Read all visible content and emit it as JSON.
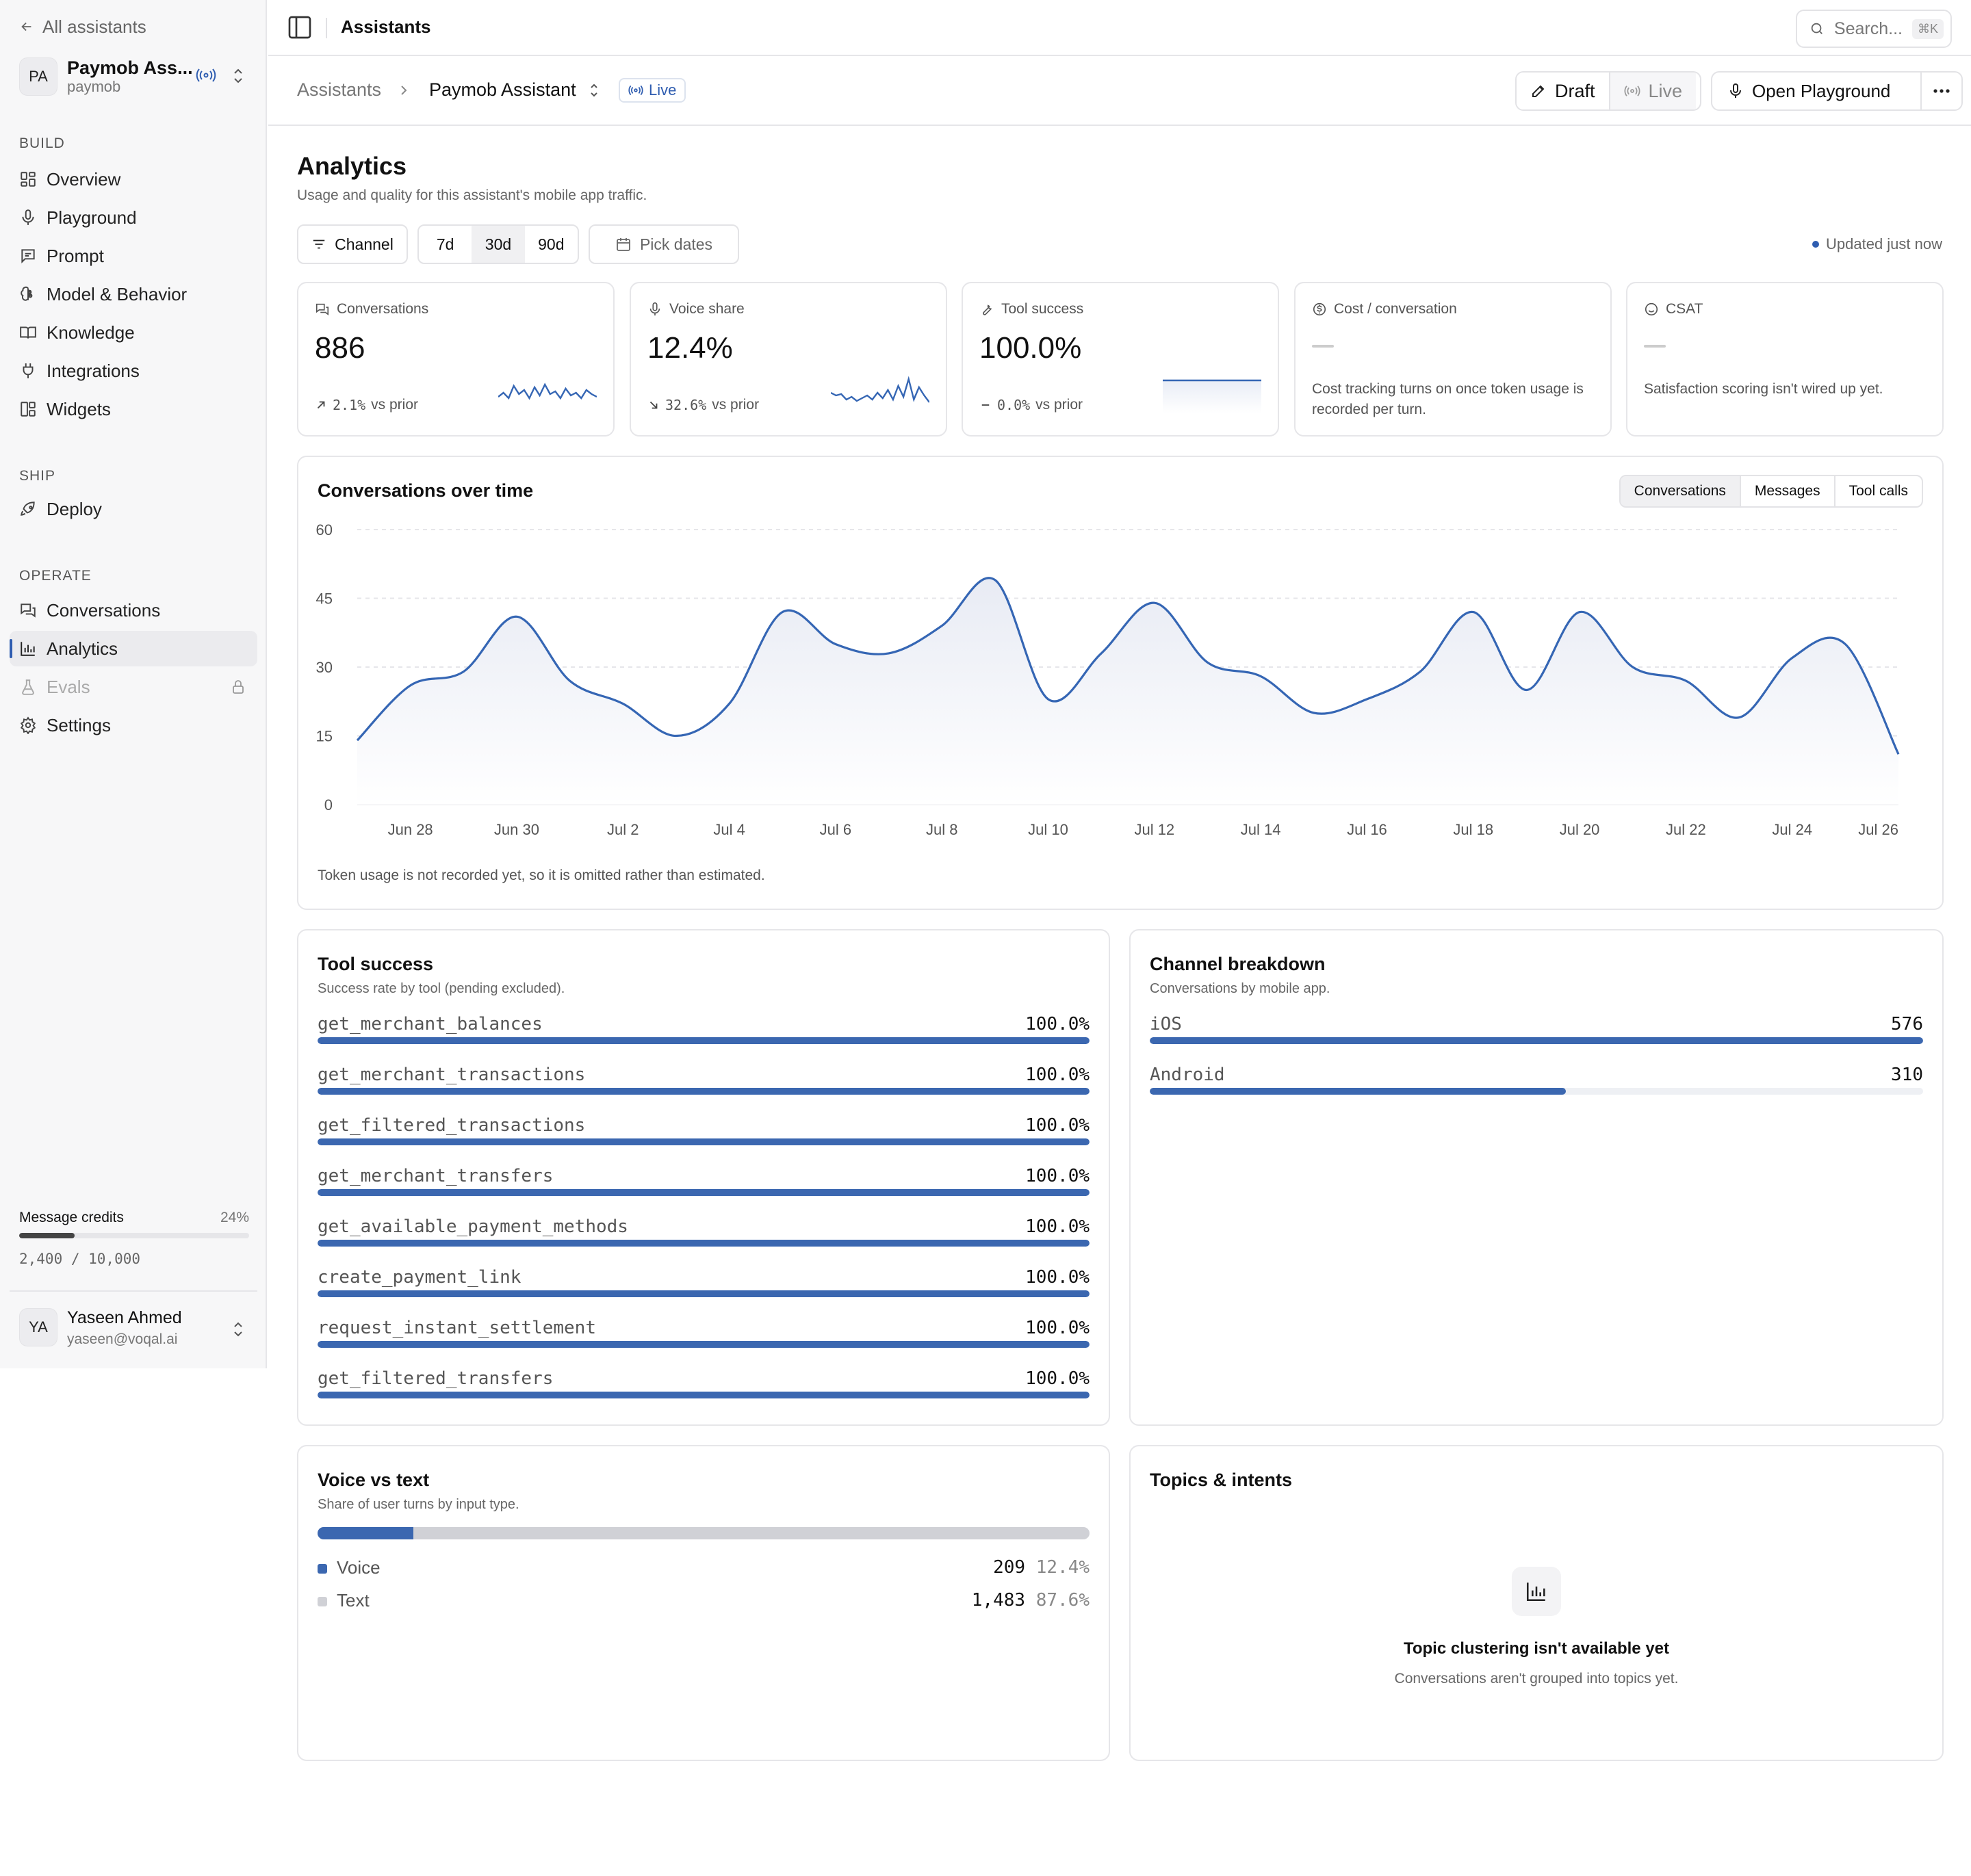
{
  "sidebar": {
    "back_label": "All assistants",
    "org": {
      "initials": "PA",
      "name": "Paymob Ass...",
      "sub": "paymob"
    },
    "sections": {
      "build": "BUILD",
      "ship": "SHIP",
      "operate": "OPERATE"
    },
    "build_items": [
      {
        "label": "Overview",
        "icon": "grid-icon"
      },
      {
        "label": "Playground",
        "icon": "mic-icon"
      },
      {
        "label": "Prompt",
        "icon": "message-icon"
      },
      {
        "label": "Model & Behavior",
        "icon": "brain-icon"
      },
      {
        "label": "Knowledge",
        "icon": "book-icon"
      },
      {
        "label": "Integrations",
        "icon": "plug-icon"
      },
      {
        "label": "Widgets",
        "icon": "widgets-icon"
      }
    ],
    "ship_items": [
      {
        "label": "Deploy",
        "icon": "rocket-icon"
      }
    ],
    "operate_items": [
      {
        "label": "Conversations",
        "icon": "chat-icon"
      },
      {
        "label": "Analytics",
        "icon": "bar-chart-icon",
        "active": true
      },
      {
        "label": "Evals",
        "icon": "flask-icon",
        "locked": true
      },
      {
        "label": "Settings",
        "icon": "gear-icon"
      }
    ],
    "credits": {
      "label": "Message credits",
      "percent": "24%",
      "fraction": 0.24,
      "count": "2,400 / 10,000"
    },
    "user": {
      "initials": "YA",
      "name": "Yaseen Ahmed",
      "email": "yaseen@voqal.ai"
    }
  },
  "topbar": {
    "title": "Assistants",
    "search_placeholder": "Search...",
    "search_shortcut": "⌘K"
  },
  "breadcrumb": {
    "root": "Assistants",
    "current": "Paymob Assistant",
    "badge": "Live"
  },
  "actions": {
    "draft": "Draft",
    "live": "Live",
    "playground": "Open Playground"
  },
  "page": {
    "title": "Analytics",
    "subtitle": "Usage and quality for this assistant's mobile app traffic."
  },
  "filters": {
    "channel": "Channel",
    "ranges": [
      "7d",
      "30d",
      "90d"
    ],
    "selected_range": "30d",
    "pick_dates": "Pick dates",
    "updated": "Updated just now"
  },
  "kpis": [
    {
      "title": "Conversations",
      "value": "886",
      "delta": "2.1%",
      "delta_suffix": "vs prior",
      "trend": "up"
    },
    {
      "title": "Voice share",
      "value": "12.4%",
      "delta": "32.6%",
      "delta_suffix": "vs prior",
      "trend": "down"
    },
    {
      "title": "Tool success",
      "value": "100.0%",
      "delta": "0.0%",
      "delta_suffix": "vs prior",
      "trend": "flat"
    },
    {
      "title": "Cost / conversation",
      "note": "Cost tracking turns on once token usage is recorded per turn."
    },
    {
      "title": "CSAT",
      "note": "Satisfaction scoring isn't wired up yet."
    }
  ],
  "conversations_chart": {
    "title": "Conversations over time",
    "tabs": [
      "Conversations",
      "Messages",
      "Tool calls"
    ],
    "selected_tab": "Conversations",
    "note": "Token usage is not recorded yet, so it is omitted rather than estimated."
  },
  "chart_data": {
    "type": "area",
    "x": [
      "Jun 27",
      "Jun 28",
      "Jun 29",
      "Jun 30",
      "Jul 1",
      "Jul 2",
      "Jul 3",
      "Jul 4",
      "Jul 5",
      "Jul 6",
      "Jul 7",
      "Jul 8",
      "Jul 9",
      "Jul 10",
      "Jul 11",
      "Jul 12",
      "Jul 13",
      "Jul 14",
      "Jul 15",
      "Jul 16",
      "Jul 17",
      "Jul 18",
      "Jul 19",
      "Jul 20",
      "Jul 21",
      "Jul 22",
      "Jul 23",
      "Jul 24",
      "Jul 25",
      "Jul 26"
    ],
    "series": [
      {
        "values": [
          14,
          26,
          29,
          41,
          27,
          22,
          15,
          22,
          42,
          35,
          33,
          39,
          49,
          23,
          33,
          44,
          31,
          28,
          20,
          23,
          29,
          42,
          25,
          42,
          30,
          27,
          19,
          32,
          35,
          11
        ]
      }
    ],
    "x_ticks": [
      "Jun 28",
      "Jun 30",
      "Jul 2",
      "Jul 4",
      "Jul 6",
      "Jul 8",
      "Jul 10",
      "Jul 12",
      "Jul 14",
      "Jul 16",
      "Jul 18",
      "Jul 20",
      "Jul 22",
      "Jul 24",
      "Jul 26"
    ],
    "y_ticks": [
      0,
      15,
      30,
      45,
      60
    ],
    "ylim": [
      0,
      60
    ],
    "grid": true,
    "colors": {
      "line": "#3566b4",
      "fill": "#eef0f6"
    }
  },
  "tool_success": {
    "title": "Tool success",
    "subtitle": "Success rate by tool (pending excluded).",
    "rows": [
      {
        "name": "get_merchant_balances",
        "value": "100.0%",
        "fraction": 1
      },
      {
        "name": "get_merchant_transactions",
        "value": "100.0%",
        "fraction": 1
      },
      {
        "name": "get_filtered_transactions",
        "value": "100.0%",
        "fraction": 1
      },
      {
        "name": "get_merchant_transfers",
        "value": "100.0%",
        "fraction": 1
      },
      {
        "name": "get_available_payment_methods",
        "value": "100.0%",
        "fraction": 1
      },
      {
        "name": "create_payment_link",
        "value": "100.0%",
        "fraction": 1
      },
      {
        "name": "request_instant_settlement",
        "value": "100.0%",
        "fraction": 1
      },
      {
        "name": "get_filtered_transfers",
        "value": "100.0%",
        "fraction": 1
      }
    ]
  },
  "channel_breakdown": {
    "title": "Channel breakdown",
    "subtitle": "Conversations by mobile app.",
    "rows": [
      {
        "name": "iOS",
        "value": "576",
        "fraction": 1
      },
      {
        "name": "Android",
        "value": "310",
        "fraction": 0.538
      }
    ]
  },
  "voice_text": {
    "title": "Voice vs text",
    "subtitle": "Share of user turns by input type.",
    "voice_fraction": 0.124,
    "rows": [
      {
        "name": "Voice",
        "count": "209",
        "share": "12.4%",
        "color": "#3b67b0"
      },
      {
        "name": "Text",
        "count": "1,483",
        "share": "87.6%",
        "color": "#d0d1d6"
      }
    ]
  },
  "topics": {
    "title": "Topics & intents",
    "empty_title": "Topic clustering isn't available yet",
    "empty_sub": "Conversations aren't grouped into topics yet."
  },
  "colors": {
    "accent": "#2f5db0",
    "bar": "#3b67b0"
  }
}
